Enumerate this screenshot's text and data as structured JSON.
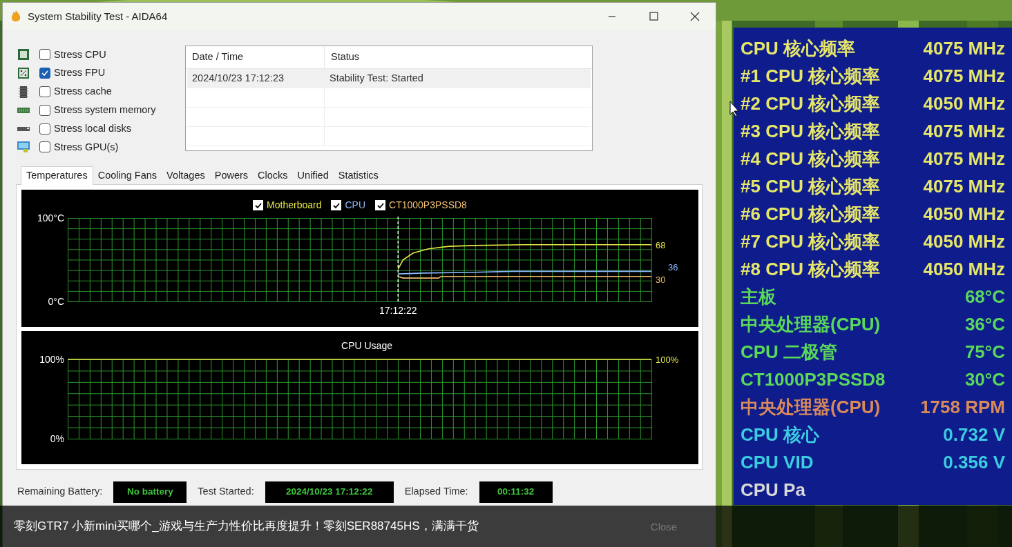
{
  "window": {
    "title": "System Stability Test - AIDA64"
  },
  "stress_options": [
    {
      "label": "Stress CPU",
      "checked": false
    },
    {
      "label": "Stress FPU",
      "checked": true
    },
    {
      "label": "Stress cache",
      "checked": false
    },
    {
      "label": "Stress system memory",
      "checked": false
    },
    {
      "label": "Stress local disks",
      "checked": false
    },
    {
      "label": "Stress GPU(s)",
      "checked": false
    }
  ],
  "log": {
    "columns": [
      "Date / Time",
      "Status"
    ],
    "rows": [
      [
        "2024/10/23 17:12:23",
        "Stability Test: Started"
      ]
    ]
  },
  "tabs": [
    {
      "label": "Temperatures",
      "selected": true
    },
    {
      "label": "Cooling Fans",
      "selected": false
    },
    {
      "label": "Voltages",
      "selected": false
    },
    {
      "label": "Powers",
      "selected": false
    },
    {
      "label": "Clocks",
      "selected": false
    },
    {
      "label": "Unified",
      "selected": false
    },
    {
      "label": "Statistics",
      "selected": false
    }
  ],
  "temperature_chart": {
    "legend": [
      {
        "label": "Motherboard",
        "checked": true,
        "color": "#e8e84a"
      },
      {
        "label": "CPU",
        "checked": true,
        "color": "#8fb8ff"
      },
      {
        "label": "CT1000P3PSSD8",
        "checked": true,
        "color": "#f0c070"
      }
    ],
    "axis_labels": [
      "100°C",
      "0°C"
    ],
    "time_label": "17:12:22",
    "end_labels": [
      "68",
      "36",
      "30"
    ]
  },
  "usage_chart": {
    "title": "CPU Usage",
    "axis_labels": [
      "100%",
      "0%"
    ],
    "end_label": "100%"
  },
  "status": [
    {
      "label": "Remaining Battery:",
      "value": "No battery"
    },
    {
      "label": "Test Started:",
      "value": "2024/10/23 17:12:22"
    },
    {
      "label": "Elapsed Time:",
      "value": "00:11:32"
    }
  ],
  "buttons": [
    "Close"
  ],
  "osd": [
    {
      "label": "CPU 核心频率",
      "value": "4075 MHz",
      "color": "#e6e66a"
    },
    {
      "label": "#1 CPU 核心频率",
      "value": "4075 MHz",
      "color": "#e6e66a"
    },
    {
      "label": "#2 CPU 核心频率",
      "value": "4050 MHz",
      "color": "#e6e66a"
    },
    {
      "label": "#3 CPU 核心频率",
      "value": "4075 MHz",
      "color": "#e6e66a"
    },
    {
      "label": "#4 CPU 核心频率",
      "value": "4075 MHz",
      "color": "#e6e66a"
    },
    {
      "label": "#5 CPU 核心频率",
      "value": "4075 MHz",
      "color": "#e6e66a"
    },
    {
      "label": "#6 CPU 核心频率",
      "value": "4050 MHz",
      "color": "#e6e66a"
    },
    {
      "label": "#7 CPU 核心频率",
      "value": "4050 MHz",
      "color": "#e6e66a"
    },
    {
      "label": "#8 CPU 核心频率",
      "value": "4050 MHz",
      "color": "#e6e66a"
    },
    {
      "label": "主板",
      "value": "68°C",
      "color": "#5ad85a"
    },
    {
      "label": "中央处理器(CPU)",
      "value": "36°C",
      "color": "#5ad85a"
    },
    {
      "label": "CPU 二极管",
      "value": "75°C",
      "color": "#5ad85a"
    },
    {
      "label": "CT1000P3PSSD8",
      "value": "30°C",
      "color": "#5ad85a"
    },
    {
      "label": "中央处理器(CPU)",
      "value": "1758 RPM",
      "color": "#d88a5a"
    },
    {
      "label": "CPU 核心",
      "value": "0.732 V",
      "color": "#3ccce0"
    },
    {
      "label": "CPU VID",
      "value": "0.356 V",
      "color": "#3ccce0"
    },
    {
      "label": "CPU Pa",
      "color": "#d8d8d8"
    }
  ],
  "caption": "零刻GTR7 小新mini买哪个_游戏与生产力性价比再度提升！零刻SER88745HS，满满干货"
}
